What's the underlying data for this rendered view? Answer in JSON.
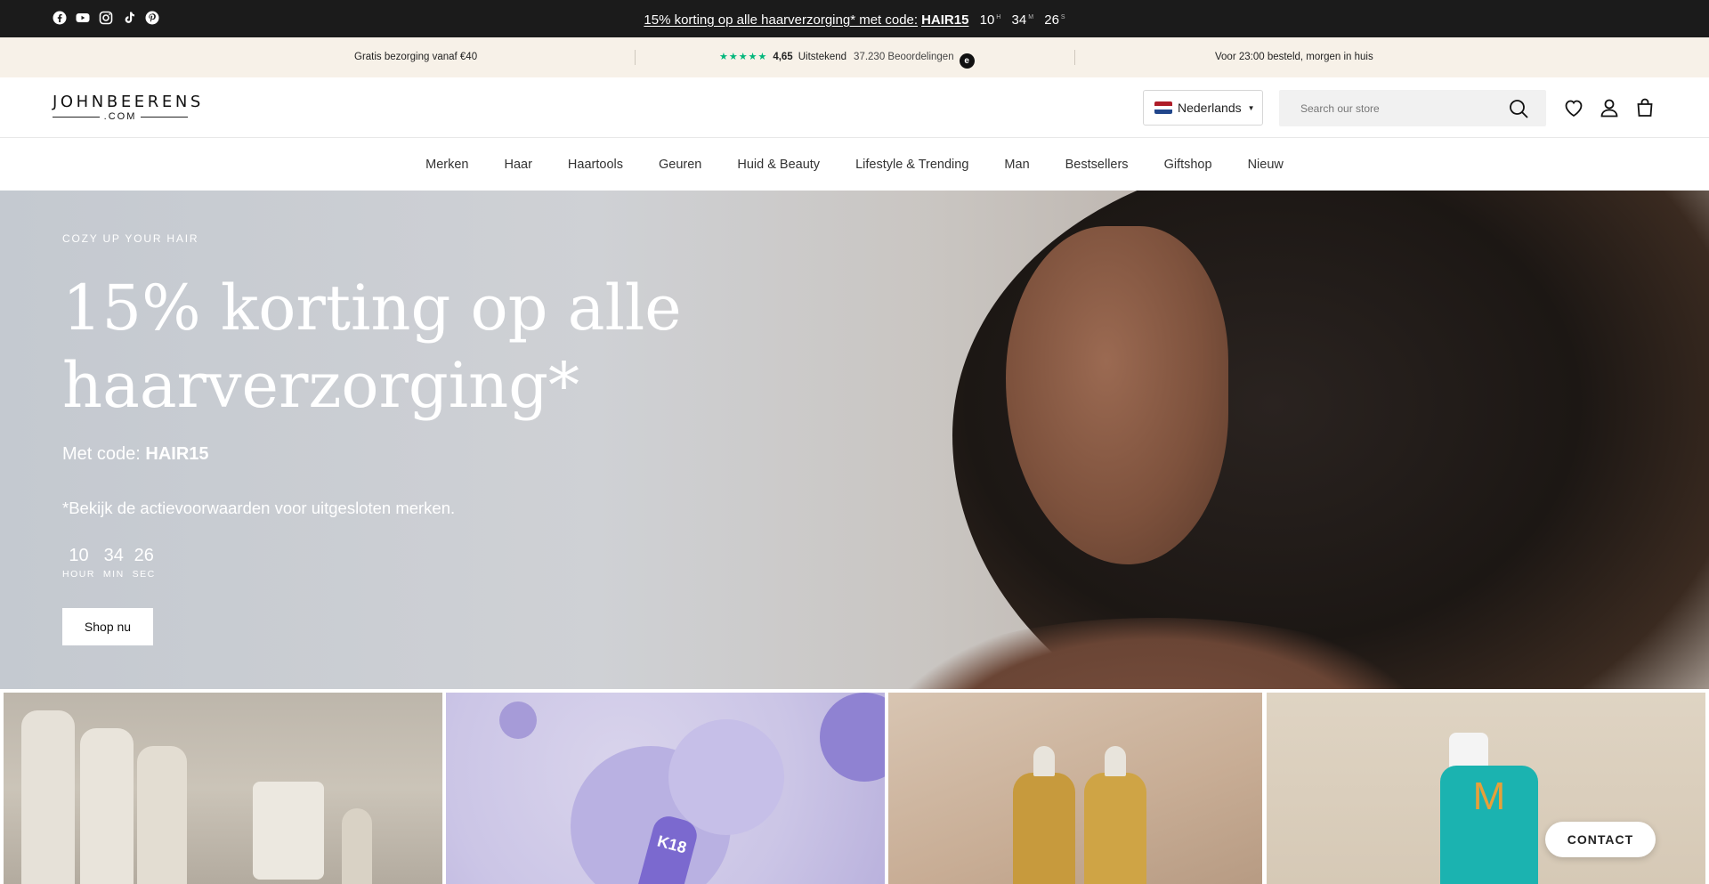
{
  "announcement": {
    "socials": [
      "facebook-icon",
      "youtube-icon",
      "instagram-icon",
      "tiktok-icon",
      "pinterest-icon"
    ],
    "promo_text": "15% korting op alle haarverzorging* met code:",
    "promo_code": "HAIR15",
    "countdown": {
      "hours": "10",
      "hours_unit": "H",
      "minutes": "34",
      "minutes_unit": "M",
      "seconds": "26",
      "seconds_unit": "S"
    }
  },
  "usp": {
    "shipping": "Gratis bezorging vanaf €40",
    "stars": "★★★★★",
    "rating": "4,65",
    "rating_label": "Uitstekend",
    "review_count": "37.230 Beoordelingen",
    "badge": "e",
    "delivery": "Voor 23:00 besteld, morgen in huis"
  },
  "header": {
    "logo_main": "JOHNBEERENS",
    "logo_sub": ".COM",
    "language": "Nederlands",
    "search_placeholder": "Search our store"
  },
  "nav": {
    "items": [
      "Merken",
      "Haar",
      "Haartools",
      "Geuren",
      "Huid & Beauty",
      "Lifestyle & Trending",
      "Man",
      "Bestsellers",
      "Giftshop",
      "Nieuw"
    ]
  },
  "hero": {
    "eyebrow": "COZY UP YOUR HAIR",
    "title": "15% korting op alle haarverzorging*",
    "code_label": "Met code:",
    "code": "HAIR15",
    "note": "*Bekijk de actievoorwaarden voor uitgesloten merken.",
    "countdown": [
      {
        "value": "10",
        "label": "HOUR"
      },
      {
        "value": "34",
        "label": "MIN"
      },
      {
        "value": "26",
        "label": "SEC"
      }
    ],
    "cta": "Shop nu"
  },
  "tiles": {
    "k18_label": "K18",
    "moroccanoil_label": "M"
  },
  "contact": {
    "label": "CONTACT"
  },
  "colors": {
    "topbar": "#1b1b1b",
    "usp_bg": "#f7f1e8",
    "trustpilot": "#00b67a"
  }
}
